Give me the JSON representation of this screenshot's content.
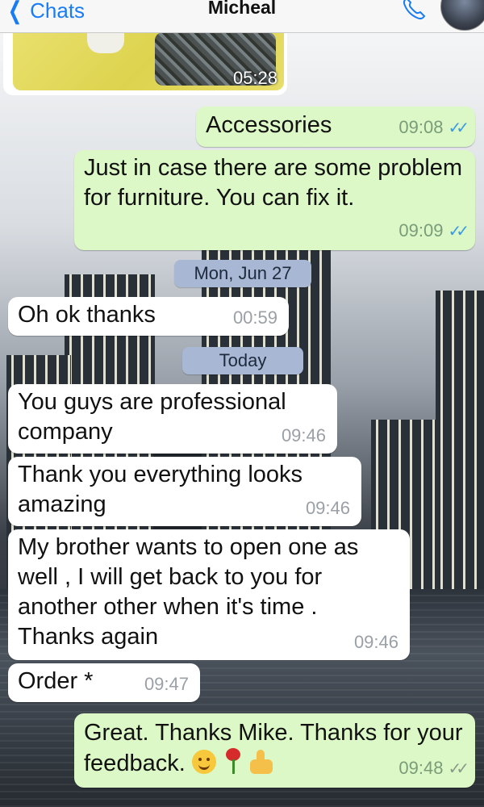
{
  "header": {
    "back_label": "Chats",
    "contact_name": "Micheal",
    "call_icon": "phone-icon",
    "avatar_icon": "contact-avatar"
  },
  "messages": [
    {
      "type": "image",
      "direction": "in",
      "time": "05:28"
    },
    {
      "direction": "out",
      "text": "Accessories",
      "time": "09:08",
      "status": "read"
    },
    {
      "direction": "out",
      "text": "Just in case there are some problem for furniture. You can fix it.",
      "time": "09:09",
      "status": "read"
    },
    {
      "type": "date",
      "text": "Mon, Jun 27"
    },
    {
      "direction": "in",
      "text": "Oh ok thanks",
      "time": "00:59"
    },
    {
      "type": "date",
      "text": "Today"
    },
    {
      "direction": "in",
      "text": "You guys are professional company",
      "time": "09:46"
    },
    {
      "direction": "in",
      "text": "Thank you everything looks amazing",
      "time": "09:46"
    },
    {
      "direction": "in",
      "text": "My brother wants to open one as well , I will get back to you for another other when it's time . Thanks again",
      "time": "09:46"
    },
    {
      "direction": "in",
      "text": "Order *",
      "time": "09:47"
    },
    {
      "direction": "out",
      "text": "Great. Thanks Mike. Thanks for your feedback.",
      "time": "09:48",
      "status": "delivered",
      "emojis": [
        "smiling-face-emoji",
        "rose-emoji",
        "thumbs-up-emoji"
      ]
    }
  ],
  "colors": {
    "incoming_bubble": "#ffffff",
    "outgoing_bubble": "#dcf8c6",
    "date_pill": "#a8b8d4",
    "link_blue": "#1a7cf5",
    "read_tick": "#3a9ae8"
  }
}
